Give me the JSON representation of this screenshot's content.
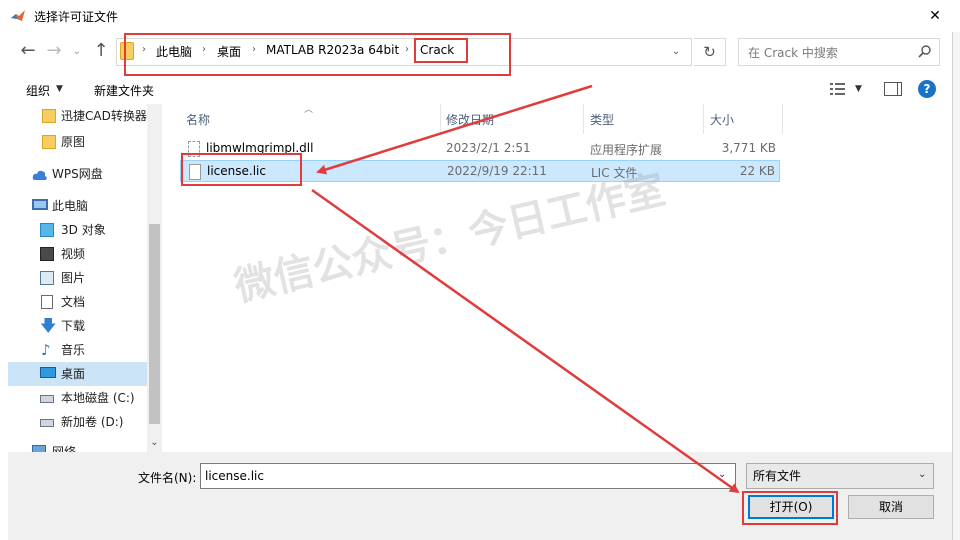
{
  "window": {
    "title": "选择许可证文件",
    "close_glyph": "✕"
  },
  "address": {
    "crumbs": [
      "此电脑",
      "桌面",
      "MATLAB R2023a 64bit",
      "Crack"
    ],
    "separator": "›",
    "search_placeholder": "在 Crack 中搜索"
  },
  "toolbar": {
    "organize": "组织",
    "new_folder": "新建文件夹"
  },
  "sidebar": {
    "items": [
      {
        "label": "迅捷CAD转换器",
        "icon": "folder-icon"
      },
      {
        "label": "原图",
        "icon": "folder-icon"
      },
      {
        "label": "WPS网盘",
        "icon": "cloud-icon"
      },
      {
        "label": "此电脑",
        "icon": "computer-icon"
      },
      {
        "label": "3D 对象",
        "icon": "cube-icon"
      },
      {
        "label": "视频",
        "icon": "video-icon"
      },
      {
        "label": "图片",
        "icon": "picture-icon"
      },
      {
        "label": "文档",
        "icon": "document-icon"
      },
      {
        "label": "下载",
        "icon": "download-icon"
      },
      {
        "label": "音乐",
        "icon": "music-icon"
      },
      {
        "label": "桌面",
        "icon": "desktop-icon"
      },
      {
        "label": "本地磁盘 (C:)",
        "icon": "drive-icon"
      },
      {
        "label": "新加卷 (D:)",
        "icon": "drive-icon"
      },
      {
        "label": "网络",
        "icon": "network-icon"
      }
    ]
  },
  "columns": {
    "name": "名称",
    "date": "修改日期",
    "type": "类型",
    "size": "大小"
  },
  "files": [
    {
      "name": "libmwlmgrimpl.dll",
      "date": "2023/2/1 2:51",
      "type": "应用程序扩展",
      "size": "3,771 KB"
    },
    {
      "name": "license.lic",
      "date": "2022/9/19 22:11",
      "type": "LIC 文件",
      "size": "22 KB"
    }
  ],
  "footer": {
    "filename_label": "文件名(N):",
    "filename_value": "license.lic",
    "filetype_value": "所有文件",
    "open_label": "打开(O)",
    "cancel_label": "取消"
  },
  "watermark": "微信公众号：今日工作室",
  "colors": {
    "selection": "#cce8ff",
    "annotation_red": "#e03c3c",
    "accent_blue": "#0078d7"
  }
}
